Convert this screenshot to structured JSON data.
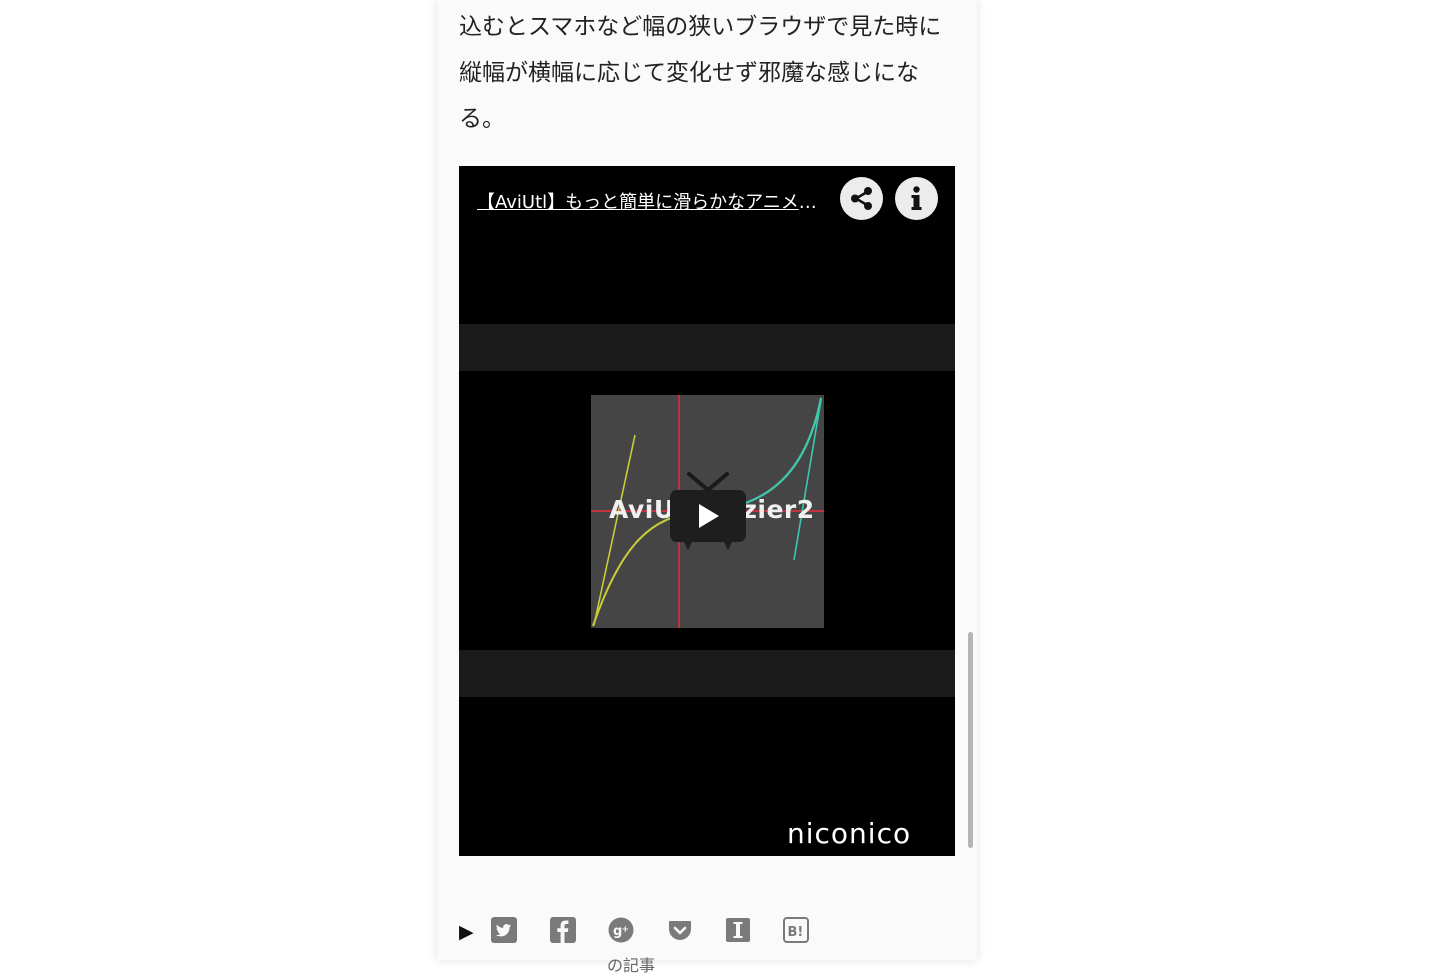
{
  "article": {
    "paragraph": "込むとスマホなど幅の狭いブラウザで見た時に縦幅が横幅に応じて変化せず邪魔な感じになる。"
  },
  "video": {
    "title": "【AviUtl】もっと簡単に滑らかなアニメーションを作るスクリプト",
    "thumbnail_caption": "AviUtl Bezier2",
    "brand": "niconico",
    "play_icon": "tv-play-icon",
    "share_icon": "share-icon",
    "info_icon": "info-icon"
  },
  "share_bar": {
    "toggle_icon": "triangle-right-icon",
    "toggle_label": "▶",
    "services": [
      "twitter",
      "facebook",
      "google-plus",
      "pocket",
      "instapaper",
      "hatena-bookmark"
    ]
  },
  "bottom": {
    "partial_text": "の記事"
  },
  "colors": {
    "page_bg": "#fafafa",
    "video_bg": "#000000",
    "band": "#1a1a1a",
    "icon_gray": "#7a7a7a",
    "curve_yellow": "#c8cc3a",
    "curve_teal": "#3cc7b0",
    "axis_red": "#c0333e"
  }
}
